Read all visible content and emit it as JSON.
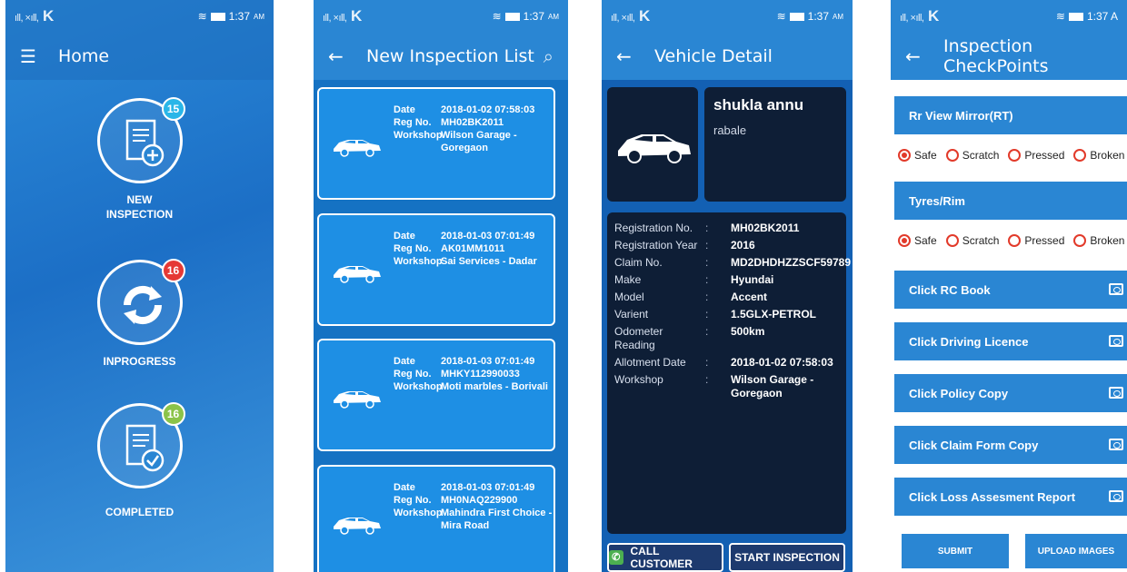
{
  "status": {
    "carrier_mark": "K",
    "time_1": "1:37",
    "time_ampm": "AM",
    "time_4": "1:37 A"
  },
  "home": {
    "title": "Home",
    "items": [
      {
        "label_line1": "NEW",
        "label_line2": "INSPECTION",
        "badge": "15",
        "badge_color": "#29b6e8"
      },
      {
        "label_line1": "INPROGRESS",
        "label_line2": "",
        "badge": "16",
        "badge_color": "#e53935"
      },
      {
        "label_line1": "COMPLETED",
        "label_line2": "",
        "badge": "16",
        "badge_color": "#8bc34a"
      }
    ]
  },
  "list": {
    "title": "New Inspection List",
    "field_labels": {
      "date": "Date",
      "reg": "Reg No.",
      "workshop": "Workshop"
    },
    "cards": [
      {
        "date": "2018-01-02 07:58:03",
        "reg": "MH02BK2011",
        "workshop": "Wilson Garage - Goregaon"
      },
      {
        "date": "2018-01-03 07:01:49",
        "reg": "AK01MM1011",
        "workshop": "Sai Services - Dadar"
      },
      {
        "date": "2018-01-03 07:01:49",
        "reg": "MHKY112990033",
        "workshop": "Moti marbles - Borivali"
      },
      {
        "date": "2018-01-03 07:01:49",
        "reg": "MH0NAQ229900",
        "workshop": "Mahindra First Choice - Mira Road"
      }
    ]
  },
  "vehicle": {
    "title": "Vehicle Detail",
    "customer_name": "shukla annu",
    "customer_area": "rabale",
    "separator": ":",
    "details": [
      {
        "label": "Registration No.",
        "value": "MH02BK2011"
      },
      {
        "label": "Registration Year",
        "value": "2016"
      },
      {
        "label": "Claim No.",
        "value": "MD2DHDHZZSCF59789"
      },
      {
        "label": "Make",
        "value": "Hyundai"
      },
      {
        "label": "Model",
        "value": "Accent"
      },
      {
        "label": "Varient",
        "value": "1.5GLX-PETROL"
      },
      {
        "label": "Odometer Reading",
        "value": "500km"
      },
      {
        "label": "Allotment Date",
        "value": "2018-01-02 07:58:03"
      },
      {
        "label": "Workshop",
        "value": "Wilson Garage - Goregaon"
      }
    ],
    "call_button": "CALL CUSTOMER",
    "start_button": "START INSPECTION"
  },
  "checkpoints": {
    "title": "Inspection CheckPoints",
    "sections": [
      {
        "name": "Rr View Mirror(RT)",
        "options": [
          "Safe",
          "Scratch",
          "Pressed",
          "Broken"
        ],
        "selected": "Safe"
      },
      {
        "name": "Tyres/Rim",
        "options": [
          "Safe",
          "Scratch",
          "Pressed",
          "Broken"
        ],
        "selected": "Safe"
      }
    ],
    "photo_items": [
      "Click RC Book",
      "Click Driving Licence",
      "Click Policy Copy",
      "Click Claim Form Copy",
      "Click Loss Assesment Report"
    ],
    "submit_button": "SUBMIT",
    "upload_button": "UPLOAD IMAGES"
  },
  "colors": {
    "primary": "#2a86d3",
    "card": "#1e8fe4",
    "dark_panel": "#0e1e36",
    "radio_red": "#e23a2a"
  }
}
